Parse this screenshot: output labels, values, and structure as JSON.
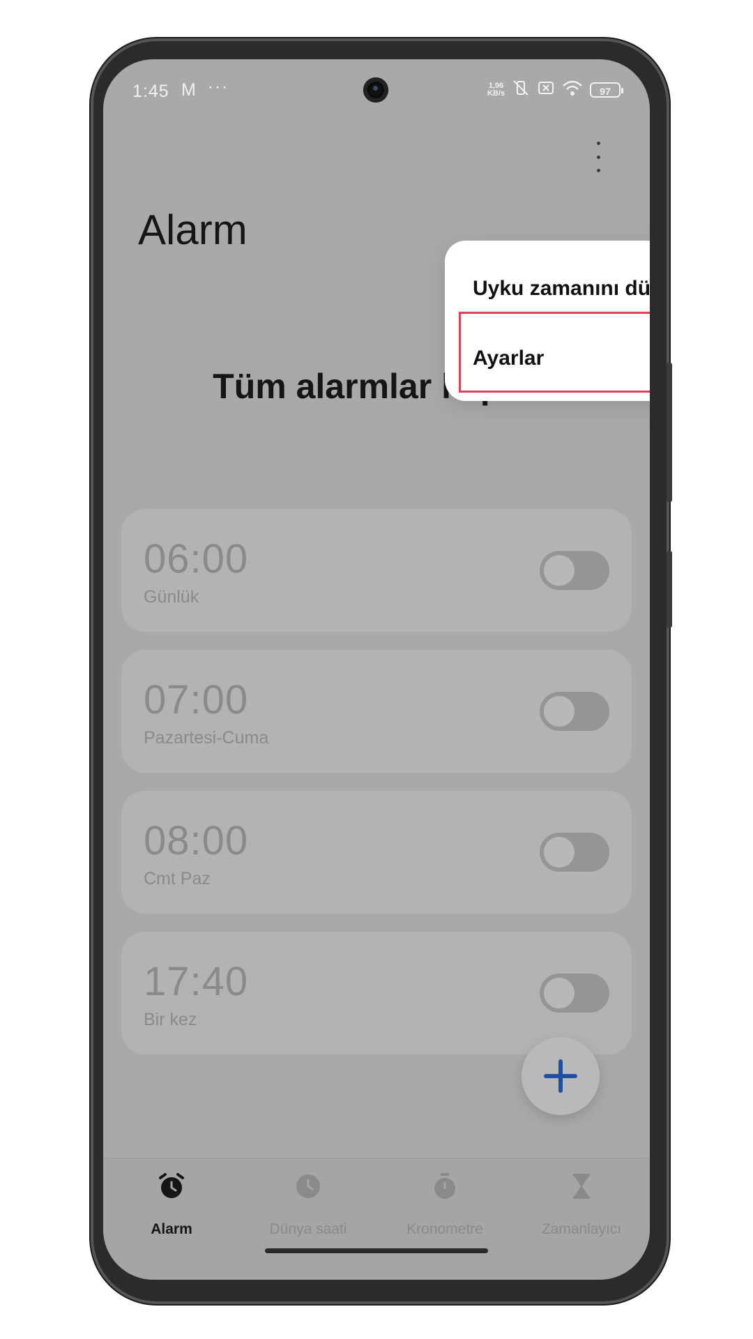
{
  "status_bar": {
    "time": "1:45",
    "notif_icon": "M",
    "more": "···",
    "net_speed_value": "1,96",
    "net_speed_unit": "KB/s",
    "battery": "97"
  },
  "header": {
    "title": "Alarm"
  },
  "overflow_menu": {
    "items": [
      {
        "label": "Uyku zamanını düzenle"
      },
      {
        "label": "Ayarlar"
      }
    ]
  },
  "main": {
    "status_text": "Tüm alarmlar kapalı",
    "alarms": [
      {
        "time": "06:00",
        "repeat": "Günlük",
        "enabled": false
      },
      {
        "time": "07:00",
        "repeat": "Pazartesi-Cuma",
        "enabled": false
      },
      {
        "time": "08:00",
        "repeat": "Cmt Paz",
        "enabled": false
      },
      {
        "time": "17:40",
        "repeat": "Bir kez",
        "enabled": false
      }
    ]
  },
  "bottom_nav": {
    "tabs": [
      {
        "label": "Alarm",
        "icon": "alarm-clock-icon",
        "active": true
      },
      {
        "label": "Dünya saati",
        "icon": "clock-icon",
        "active": false
      },
      {
        "label": "Kronometre",
        "icon": "stopwatch-icon",
        "active": false
      },
      {
        "label": "Zamanlayıcı",
        "icon": "hourglass-icon",
        "active": false
      }
    ]
  },
  "colors": {
    "accent": "#1f4fa3",
    "highlight": "#e0405a",
    "dim_overlay": "#a9a9a9"
  }
}
